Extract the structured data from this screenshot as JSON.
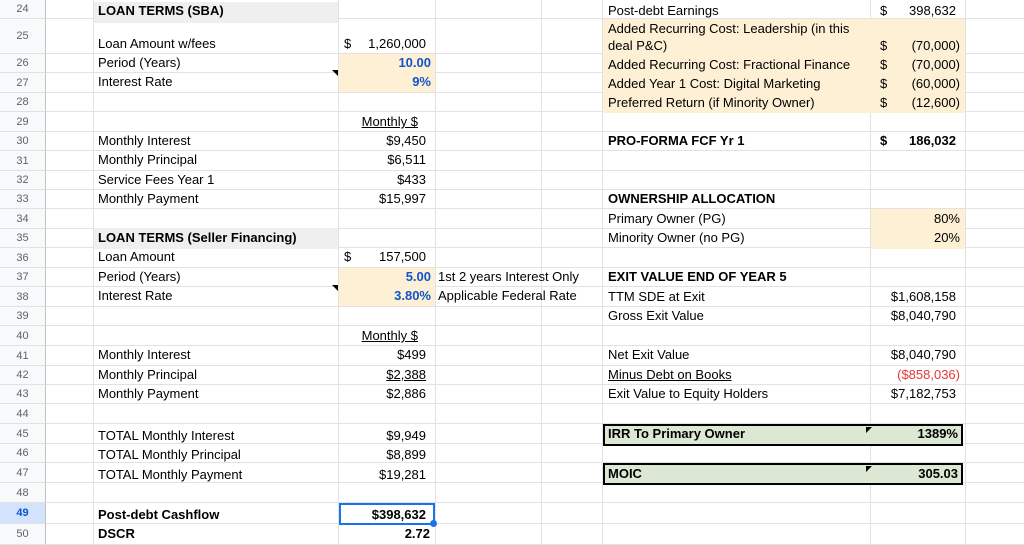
{
  "row_numbers": [
    "24",
    "25",
    "26",
    "27",
    "28",
    "29",
    "30",
    "31",
    "32",
    "33",
    "34",
    "35",
    "36",
    "37",
    "38",
    "39",
    "40",
    "41",
    "42",
    "43",
    "44",
    "45",
    "46",
    "47",
    "48",
    "49",
    "50"
  ],
  "sba": {
    "title": "LOAN TERMS (SBA)",
    "loan_amount_label": "Loan Amount w/fees",
    "loan_amount_cur": "$",
    "loan_amount": "1,260,000",
    "period_label": "Period (Years)",
    "period": "10.00",
    "rate_label": "Interest Rate",
    "rate": "9%",
    "monthly_header": "Monthly $",
    "monthly_interest_label": "Monthly Interest",
    "monthly_interest": "$9,450",
    "monthly_principal_label": "Monthly Principal",
    "monthly_principal": "$6,511",
    "service_fees_label": "Service Fees Year 1",
    "service_fees": "$433",
    "monthly_payment_label": "Monthly Payment",
    "monthly_payment": "$15,997"
  },
  "seller": {
    "title": "LOAN TERMS (Seller Financing)",
    "loan_amount_label": "Loan Amount",
    "loan_amount_cur": "$",
    "loan_amount": "157,500",
    "period_label": "Period (Years)",
    "period": "5.00",
    "period_note": "1st 2 years Interest Only",
    "rate_label": "Interest Rate",
    "rate": "3.80%",
    "rate_note": "Applicable Federal Rate",
    "monthly_header": "Monthly $",
    "monthly_interest_label": "Monthly Interest",
    "monthly_interest": "$499",
    "monthly_principal_label": "Monthly Principal",
    "monthly_principal": "$2,388",
    "monthly_payment_label": "Monthly Payment",
    "monthly_payment": "$2,886"
  },
  "totals": {
    "interest_label": "TOTAL Monthly Interest",
    "interest": "$9,949",
    "principal_label": "TOTAL Monthly Principal",
    "principal": "$8,899",
    "payment_label": "TOTAL Monthly Payment",
    "payment": "$19,281",
    "cashflow_label": "Post-debt Cashflow",
    "cashflow": "$398,632",
    "dscr_label": "DSCR",
    "dscr": "2.72"
  },
  "right": {
    "post_debt_label": "Post-debt Earnings",
    "post_debt_cur": "$",
    "post_debt": "398,632",
    "leadership_label_1": "Added Recurring Cost: Leadership (in this",
    "leadership_label_2": "deal P&C)",
    "leadership_cur": "$",
    "leadership": "(70,000)",
    "fractional_label": "Added Recurring Cost: Fractional Finance",
    "fractional_cur": "$",
    "fractional": "(70,000)",
    "marketing_label": "Added Year 1 Cost: Digital Marketing",
    "marketing_cur": "$",
    "marketing": "(60,000)",
    "preferred_label": "Preferred Return (if Minority Owner)",
    "preferred_cur": "$",
    "preferred": "(12,600)",
    "proforma_label": "PRO-FORMA FCF Yr 1",
    "proforma_cur": "$",
    "proforma": "186,032",
    "ownership_title": "OWNERSHIP ALLOCATION",
    "primary_label": "Primary Owner (PG)",
    "primary": "80%",
    "minority_label": "Minority Owner (no PG)",
    "minority": "20%",
    "exit_title": "EXIT VALUE END OF YEAR 5",
    "ttm_label": "TTM SDE at Exit",
    "ttm": "$1,608,158",
    "gross_label": "Gross Exit Value",
    "gross": "$8,040,790",
    "net_label": "Net Exit Value",
    "net": "$8,040,790",
    "debt_label": "Minus Debt on Books",
    "debt": "($858,036)",
    "equity_label": "Exit Value to Equity Holders",
    "equity": "$7,182,753",
    "irr_label": "IRR To Primary Owner",
    "irr": "1389%",
    "moic_label": "MOIC",
    "moic": "305.03"
  }
}
